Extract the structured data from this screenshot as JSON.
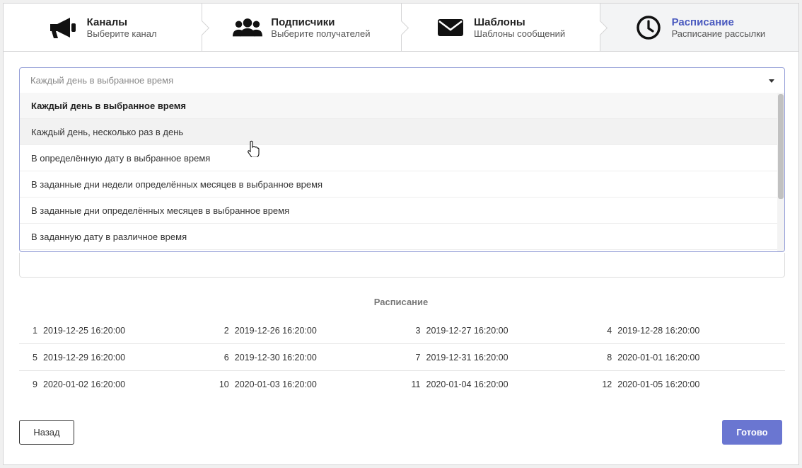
{
  "steps": [
    {
      "title": "Каналы",
      "desc": "Выберите канал",
      "icon": "megaphone-icon"
    },
    {
      "title": "Подписчики",
      "desc": "Выберите получателей",
      "icon": "users-icon"
    },
    {
      "title": "Шаблоны",
      "desc": "Шаблоны сообщений",
      "icon": "envelope-icon"
    },
    {
      "title": "Расписание",
      "desc": "Расписание рассылки",
      "icon": "clock-icon"
    }
  ],
  "select": {
    "placeholder": "Каждый день в выбранное время",
    "options": [
      "Каждый день в выбранное время",
      "Каждый день, несколько раз в день",
      "В определённую дату в выбранное время",
      "В заданные дни недели определённых месяцев в выбранное время",
      "В заданные дни определённых месяцев в выбранное время",
      "В заданную дату в различное время"
    ]
  },
  "schedule": {
    "title": "Расписание",
    "rows": [
      [
        {
          "n": "1",
          "d": "2019-12-25 16:20:00"
        },
        {
          "n": "2",
          "d": "2019-12-26 16:20:00"
        },
        {
          "n": "3",
          "d": "2019-12-27 16:20:00"
        },
        {
          "n": "4",
          "d": "2019-12-28 16:20:00"
        }
      ],
      [
        {
          "n": "5",
          "d": "2019-12-29 16:20:00"
        },
        {
          "n": "6",
          "d": "2019-12-30 16:20:00"
        },
        {
          "n": "7",
          "d": "2019-12-31 16:20:00"
        },
        {
          "n": "8",
          "d": "2020-01-01 16:20:00"
        }
      ],
      [
        {
          "n": "9",
          "d": "2020-01-02 16:20:00"
        },
        {
          "n": "10",
          "d": "2020-01-03 16:20:00"
        },
        {
          "n": "11",
          "d": "2020-01-04 16:20:00"
        },
        {
          "n": "12",
          "d": "2020-01-05 16:20:00"
        }
      ]
    ]
  },
  "buttons": {
    "back": "Назад",
    "done": "Готово"
  },
  "colors": {
    "accent": "#4a5abf",
    "primary_button": "#6a76d1"
  }
}
